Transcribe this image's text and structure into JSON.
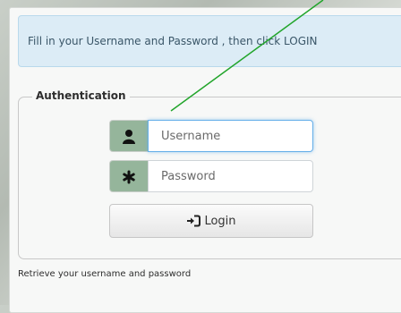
{
  "info": {
    "message": "Fill in your Username and Password , then click LOGIN",
    "color": "#dcecf6"
  },
  "auth": {
    "legend": "Authentication",
    "username_placeholder": "Username",
    "username_value": "",
    "password_placeholder": "Password",
    "password_value": "",
    "username_icon": "user-icon",
    "password_icon": "asterisk-icon",
    "addon_color": "#95b59b",
    "login_label": "Login",
    "login_icon": "sign-in-icon"
  },
  "links": {
    "retrieve": "Retrieve your username and password"
  },
  "annotation": {
    "arrow_color": "#22a52b"
  }
}
